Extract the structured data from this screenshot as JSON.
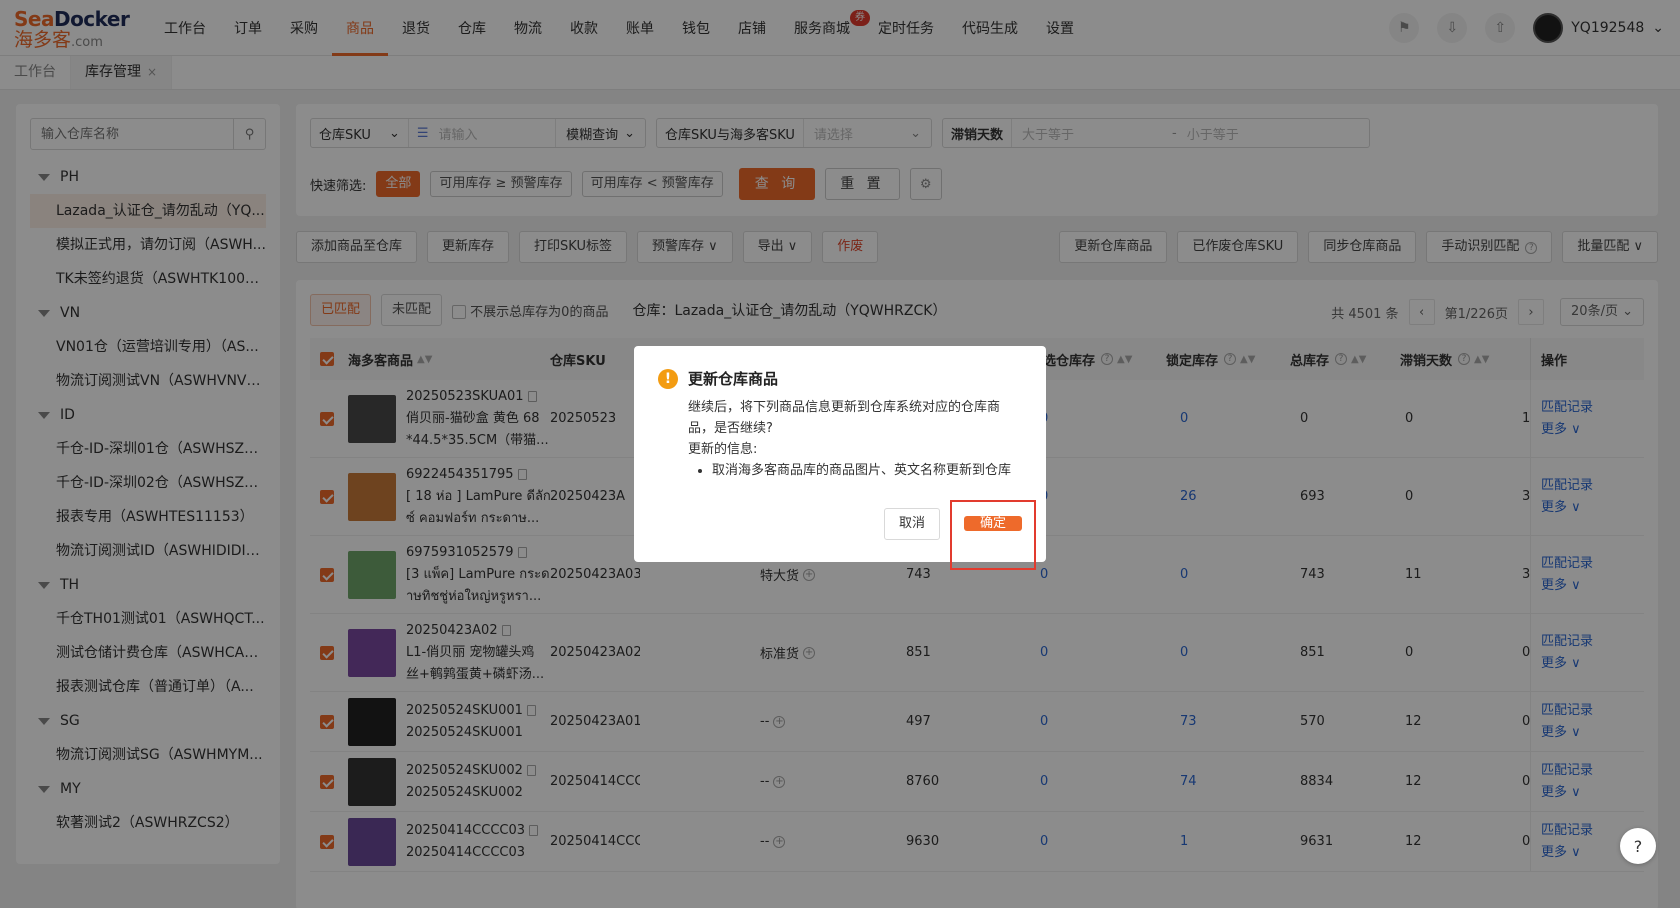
{
  "brand": {
    "logo_top_a": "Sea",
    "logo_top_b": "Docker",
    "logo_bottom": "海多客",
    "logo_domain": ".com"
  },
  "nav": {
    "items": [
      "工作台",
      "订单",
      "采购",
      "商品",
      "退货",
      "仓库",
      "物流",
      "收款",
      "账单",
      "钱包",
      "店铺",
      "服务商城",
      "定时任务",
      "代码生成",
      "设置"
    ],
    "active_index": 3,
    "badge": "券"
  },
  "user": {
    "name": "YQ192548"
  },
  "page_tabs": [
    {
      "label": "工作台"
    },
    {
      "label": "库存管理",
      "close": "×"
    }
  ],
  "sidebar": {
    "search_placeholder": "输入仓库名称",
    "groups": [
      {
        "name": "PH",
        "items": [
          "Lazada_认证仓_请勿乱动（YQ...",
          "模拟正式用，请勿订阅（ASWH...",
          "TK未签约退货（ASWHTK1003..."
        ]
      },
      {
        "name": "VN",
        "items": [
          "VN01仓（运营培训专用）（AS...",
          "物流订阅测试VN（ASWHVNVN..."
        ]
      },
      {
        "name": "ID",
        "items": [
          "千仓-ID-深圳01仓（ASWHSZ0...",
          "千仓-ID-深圳02仓（ASWHSZ0...",
          "报表专用（ASWHTES11153）",
          "物流订阅测试ID（ASWHIDIDID）"
        ]
      },
      {
        "name": "TH",
        "items": [
          "千仓TH01测试01（ASWHQCT...",
          "测试仓储计费仓库（ASWHCAS...",
          "报表测试仓库（普通订单）（A..."
        ]
      },
      {
        "name": "SG",
        "items": [
          "物流订阅测试SG（ASWHMYM..."
        ]
      },
      {
        "name": "MY",
        "items": [
          "软著测试2（ASWHRZCS2）"
        ]
      }
    ]
  },
  "filter": {
    "sku_field": "仓库SKU",
    "sku_placeholder": "请输入",
    "match_mode": "模糊查询",
    "map_field": "仓库SKU与海多客SKU",
    "map_placeholder": "请选择",
    "stale_label": "滞销天数",
    "stale_min_placeholder": "大于等于",
    "stale_sep": "-",
    "stale_max_placeholder": "小于等于",
    "quick_label": "快速筛选:",
    "quick_chips": [
      "全部",
      "可用库存 ≥ 预警库存",
      "可用库存 < 预警库存"
    ],
    "query_btn": "查 询",
    "reset_btn": "重 置"
  },
  "toolbar": {
    "left": [
      "添加商品至仓库",
      "更新库存",
      "打印SKU标签",
      "预警库存 ∨",
      "导出 ∨"
    ],
    "danger": "作废",
    "right": [
      "更新仓库商品",
      "已作废仓库SKU",
      "同步仓库商品",
      "手动识别匹配",
      "批量匹配 ∨"
    ]
  },
  "table_top": {
    "tab_matched": "已匹配",
    "tab_unmatched": "未匹配",
    "hide_zero": "不展示总库存为0的商品",
    "warehouse": "仓库：Lazada_认证仓_请勿乱动（YQWHRZCK）",
    "total": "共 4501 条",
    "page": "第1/226页",
    "page_size": "20条/页"
  },
  "columns": {
    "product": "海多客商品",
    "sku": "仓库SKU",
    "preferred": "优选仓库存",
    "locked": "锁定库存",
    "total": "总库存",
    "stale": "滞销天数",
    "op": "操作"
  },
  "rows": [
    {
      "sku1": "20250523SKUA01",
      "name1": "俏贝丽-猫砂盒 黄色 68",
      "name2": "*44.5*35.5CM（带猫...",
      "wsku": "20250523",
      "type": "",
      "avail": "",
      "pref": "0",
      "lock": "0",
      "total": "0",
      "stale": "0",
      "last": "1",
      "img": "#4a4a4a"
    },
    {
      "sku1": "6922454351795",
      "name1": "[ 18 ห่อ ] LamPure ดีลัก",
      "name2": "ซ์ คอมฟอร์ท กระดาษ...",
      "wsku": "20250423A",
      "type": "",
      "avail": "",
      "pref": "0",
      "lock": "26",
      "total": "693",
      "stale": "0",
      "last": "3",
      "img": "#c97a3a"
    },
    {
      "sku1": "6975931052579",
      "name1": "[3 แพ็ค] LamPure กระด",
      "name2": "าษทิชชู่ห่อใหญ่หรูหรา...",
      "wsku": "20250423A03",
      "type": "特大货",
      "avail": "743",
      "pref": "0",
      "lock": "0",
      "total": "743",
      "stale": "11",
      "last": "3",
      "img": "#6fa66b"
    },
    {
      "sku1": "20250423A02",
      "name1": "L1-俏贝丽 宠物罐头鸡",
      "name2": "丝+鹌鹑蛋黄+磷虾汤...",
      "wsku": "20250423A02",
      "type": "标准货",
      "avail": "851",
      "pref": "0",
      "lock": "0",
      "total": "851",
      "stale": "0",
      "last": "0",
      "img": "#7a4aa0"
    },
    {
      "sku1": "20250524SKU001",
      "name1": "20250524SKU001",
      "name2": "",
      "wsku": "20250423A01",
      "type": "--",
      "avail": "497",
      "pref": "0",
      "lock": "73",
      "total": "570",
      "stale": "12",
      "last": "0",
      "img": "#222222"
    },
    {
      "sku1": "20250524SKU002",
      "name1": "20250524SKU002",
      "name2": "",
      "wsku": "20250414CCCC04",
      "type": "--",
      "avail": "8760",
      "pref": "0",
      "lock": "74",
      "total": "8834",
      "stale": "12",
      "last": "0",
      "img": "#333333"
    },
    {
      "sku1": "20250414CCCC03",
      "name1": "20250414CCCC03",
      "name2": "",
      "wsku": "20250414CCCC03",
      "type": "--",
      "avail": "9630",
      "pref": "0",
      "lock": "1",
      "total": "9631",
      "stale": "12",
      "last": "0",
      "img": "#6b4a9a"
    }
  ],
  "row_ops": {
    "match": "匹配记录",
    "more": "更多 ∨"
  },
  "modal": {
    "title": "更新仓库商品",
    "line1": "继续后，将下列商品信息更新到仓库系统对应的仓库商",
    "line2": "品，是否继续?",
    "sub": "更新的信息:",
    "bullet": "取消海多客商品库的商品图片、英文名称更新到仓库",
    "cancel": "取消",
    "ok": "确定"
  },
  "help": "?"
}
